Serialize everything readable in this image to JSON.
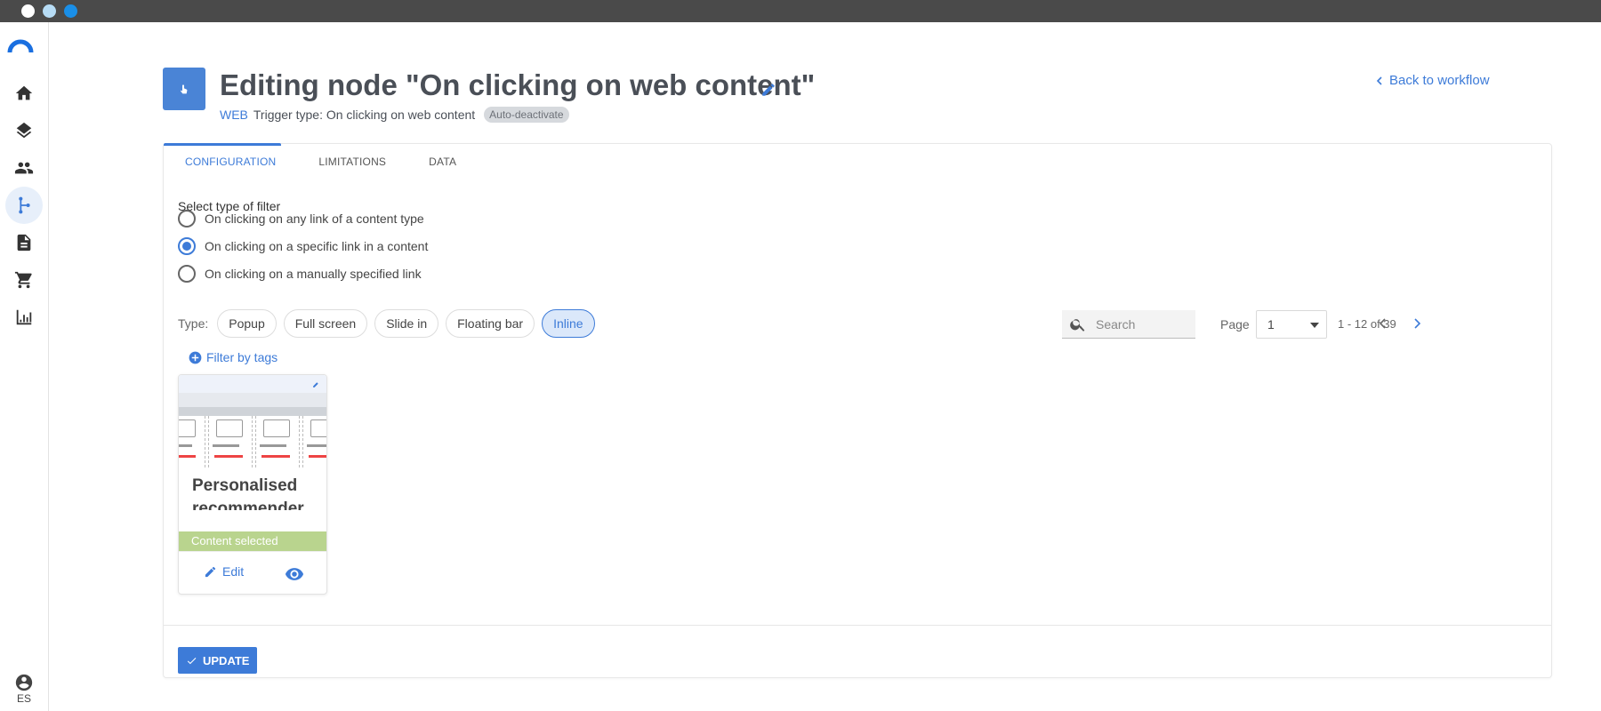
{
  "window": {
    "traffic_lights": [
      "#ffffff",
      "#b7dcf5",
      "#1a8fe8"
    ]
  },
  "sidebar": {
    "items": [
      {
        "name": "home",
        "icon": "home-icon"
      },
      {
        "name": "layers",
        "icon": "layers-icon"
      },
      {
        "name": "people",
        "icon": "people-icon"
      },
      {
        "name": "workflows",
        "icon": "flow-icon",
        "active": true
      },
      {
        "name": "documents",
        "icon": "document-icon"
      },
      {
        "name": "cart",
        "icon": "cart-icon"
      },
      {
        "name": "analytics",
        "icon": "bar-chart-icon"
      }
    ],
    "user_lang": "ES"
  },
  "header": {
    "title": "Editing node \"On clicking on web content\"",
    "channel": "WEB",
    "trigger_text": "Trigger type: On clicking on web content",
    "badge": "Auto-deactivate",
    "back_link": "Back to workflow"
  },
  "tabs": [
    {
      "label": "CONFIGURATION",
      "active": true
    },
    {
      "label": "LIMITATIONS",
      "active": false
    },
    {
      "label": "DATA",
      "active": false
    }
  ],
  "filter": {
    "label": "Select type of filter",
    "options": [
      {
        "label": "On clicking on any link of a content type",
        "checked": false
      },
      {
        "label": "On clicking on a specific link in a content",
        "checked": true
      },
      {
        "label": "On clicking on a manually specified link",
        "checked": false
      }
    ]
  },
  "types": {
    "label": "Type:",
    "chips": [
      {
        "label": "Popup",
        "active": false
      },
      {
        "label": "Full screen",
        "active": false
      },
      {
        "label": "Slide in",
        "active": false
      },
      {
        "label": "Floating bar",
        "active": false
      },
      {
        "label": "Inline",
        "active": true
      }
    ]
  },
  "search": {
    "placeholder": "Search",
    "value": ""
  },
  "pagination": {
    "label": "Page",
    "current": "1",
    "range": "1 - 12 of 39"
  },
  "filter_tags": "Filter by tags",
  "content_card": {
    "title": "Personalised recommender",
    "status": "Content selected",
    "edit_label": "Edit"
  },
  "footer": {
    "update_label": "UPDATE"
  },
  "colors": {
    "accent": "#3d7bd8",
    "selected": "#b9d48e",
    "badge": "#d6d9dd"
  }
}
